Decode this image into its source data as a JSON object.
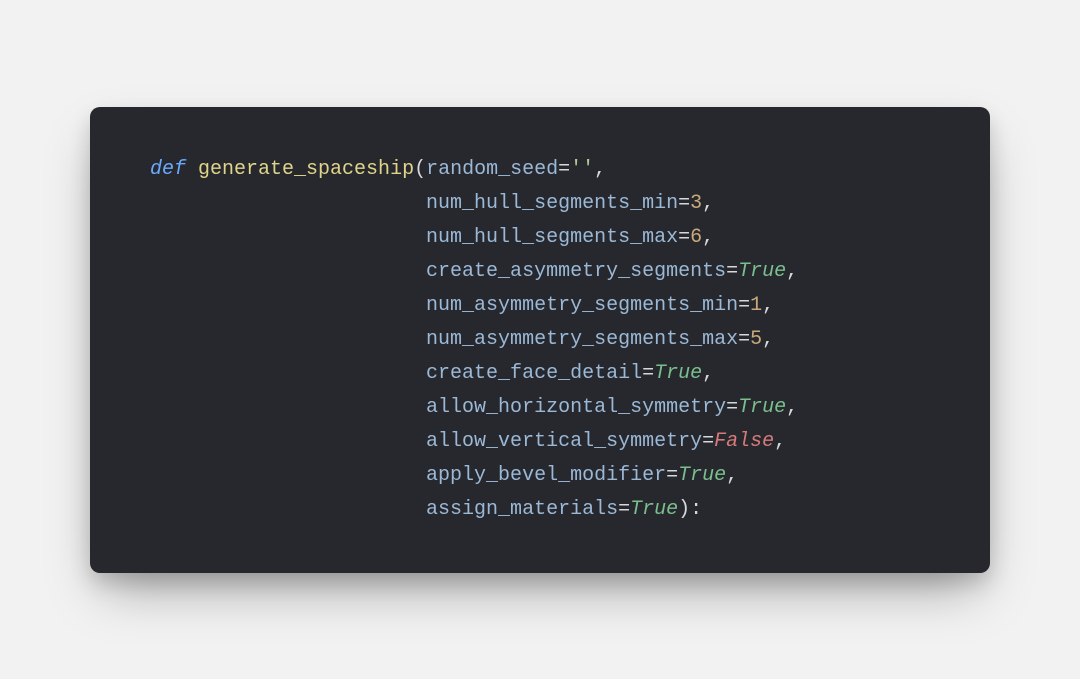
{
  "colors": {
    "page_bg": "#f2f2f2",
    "card_bg": "#26282d",
    "keyword": "#6aa9ff",
    "funcname": "#e0d48a",
    "param": "#9bb8d6",
    "punct": "#d5d9dd",
    "string": "#b4c99a",
    "number": "#c9a97b",
    "bool_true": "#7bbf8e",
    "bool_false": "#d77a7a"
  },
  "code": {
    "keyword_def": "def",
    "function_name": "generate_spaceship",
    "open_paren": "(",
    "close_paren_colon": "):",
    "eq": "=",
    "comma": ",",
    "empty_string": "''",
    "params": [
      {
        "name": "random_seed",
        "value_kind": "string",
        "value": "''"
      },
      {
        "name": "num_hull_segments_min",
        "value_kind": "number",
        "value": "3"
      },
      {
        "name": "num_hull_segments_max",
        "value_kind": "number",
        "value": "6"
      },
      {
        "name": "create_asymmetry_segments",
        "value_kind": "true",
        "value": "True"
      },
      {
        "name": "num_asymmetry_segments_min",
        "value_kind": "number",
        "value": "1"
      },
      {
        "name": "num_asymmetry_segments_max",
        "value_kind": "number",
        "value": "5"
      },
      {
        "name": "create_face_detail",
        "value_kind": "true",
        "value": "True"
      },
      {
        "name": "allow_horizontal_symmetry",
        "value_kind": "true",
        "value": "True"
      },
      {
        "name": "allow_vertical_symmetry",
        "value_kind": "false",
        "value": "False"
      },
      {
        "name": "apply_bevel_modifier",
        "value_kind": "true",
        "value": "True"
      },
      {
        "name": "assign_materials",
        "value_kind": "true",
        "value": "True"
      }
    ],
    "align_indent": "                       "
  }
}
